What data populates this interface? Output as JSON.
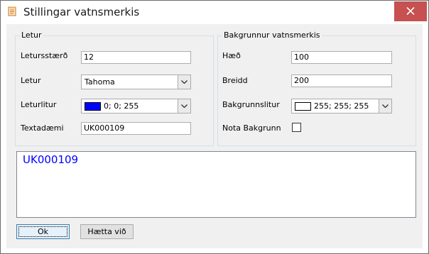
{
  "window": {
    "title": "Stillingar vatnsmerkis"
  },
  "colors": {
    "close_bg": "#c75050",
    "preview_text": "#0000ff",
    "font_color_swatch": "#0000ff",
    "background_swatch": "#ffffff"
  },
  "icons": {
    "app": "document-icon",
    "close": "close-icon",
    "dropdown": "chevron-down-icon"
  },
  "font_group": {
    "title": "Letur",
    "size_label": "Letursstærð",
    "size_value": "12",
    "font_label": "Letur",
    "font_value": "Tahoma",
    "color_label": "Leturlitur",
    "color_value": "0; 0; 255",
    "sample_label": "Textadæmi",
    "sample_value": "UK000109"
  },
  "background_group": {
    "title": "Bakgrunnur vatnsmerkis",
    "height_label": "Hæð",
    "height_value": "100",
    "width_label": "Breidd",
    "width_value": "200",
    "color_label": "Bakgrunnslitur",
    "color_value": "255; 255; 255",
    "use_bg_label": "Nota Bakgrunn",
    "use_bg_checked": false
  },
  "preview": {
    "text": "UK000109"
  },
  "buttons": {
    "ok": "Ok",
    "cancel": "Hætta við"
  }
}
